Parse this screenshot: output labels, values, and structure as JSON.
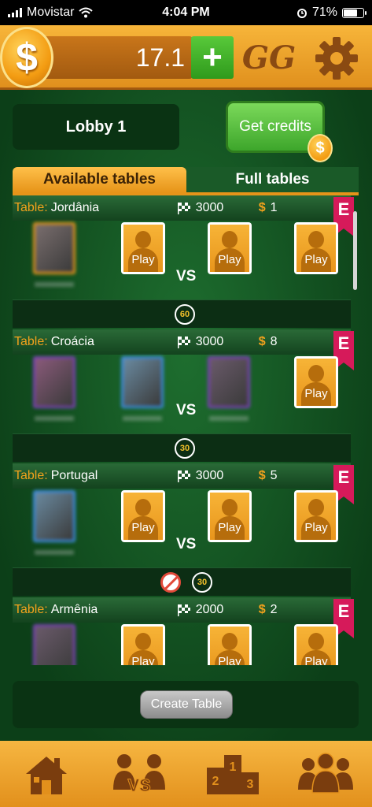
{
  "status_bar": {
    "carrier": "Movistar",
    "time": "4:04 PM",
    "battery": "71%"
  },
  "wallet": {
    "balance": "17.1",
    "add_label": "+",
    "coin_symbol": "$"
  },
  "header": {
    "logo_text": "GG"
  },
  "lobby": {
    "name": "Lobby 1",
    "get_credits": "Get credits",
    "credits_coin": "$"
  },
  "tabs": [
    {
      "label": "Available tables",
      "active": true
    },
    {
      "label": "Full tables",
      "active": false
    }
  ],
  "tables": [
    {
      "label": "Table:",
      "name": "Jordânia",
      "points": "3000",
      "bet": "1",
      "badge": "E",
      "vs": "VS",
      "timer": "60",
      "seats": [
        "player",
        "play",
        "play",
        "play"
      ],
      "play_label": "Play",
      "no_chat": false
    },
    {
      "label": "Table:",
      "name": "Croácia",
      "points": "3000",
      "bet": "8",
      "badge": "E",
      "vs": "VS",
      "timer": "30",
      "seats": [
        "player",
        "player",
        "player",
        "play"
      ],
      "play_label": "Play",
      "no_chat": false
    },
    {
      "label": "Table:",
      "name": "Portugal",
      "points": "3000",
      "bet": "5",
      "badge": "E",
      "vs": "VS",
      "timer": "30",
      "seats": [
        "player",
        "play",
        "play",
        "play"
      ],
      "play_label": "Play",
      "no_chat": true
    },
    {
      "label": "Table:",
      "name": "Armênia",
      "points": "2000",
      "bet": "2",
      "badge": "E",
      "vs": "VS",
      "timer": "",
      "seats": [
        "player",
        "play",
        "play",
        "play"
      ],
      "play_label": "Play",
      "no_chat": false
    }
  ],
  "create_table": "Create Table",
  "bottom_nav": [
    {
      "icon": "home-icon"
    },
    {
      "icon": "versus-icon",
      "text": "VS"
    },
    {
      "icon": "ranking-podium-icon",
      "podium": [
        "1",
        "2",
        "3"
      ]
    },
    {
      "icon": "friends-icon"
    }
  ],
  "colors": {
    "orange": "#f3a21c",
    "green_dark": "#0f4a1e",
    "badge_pink": "#d61a5a"
  }
}
